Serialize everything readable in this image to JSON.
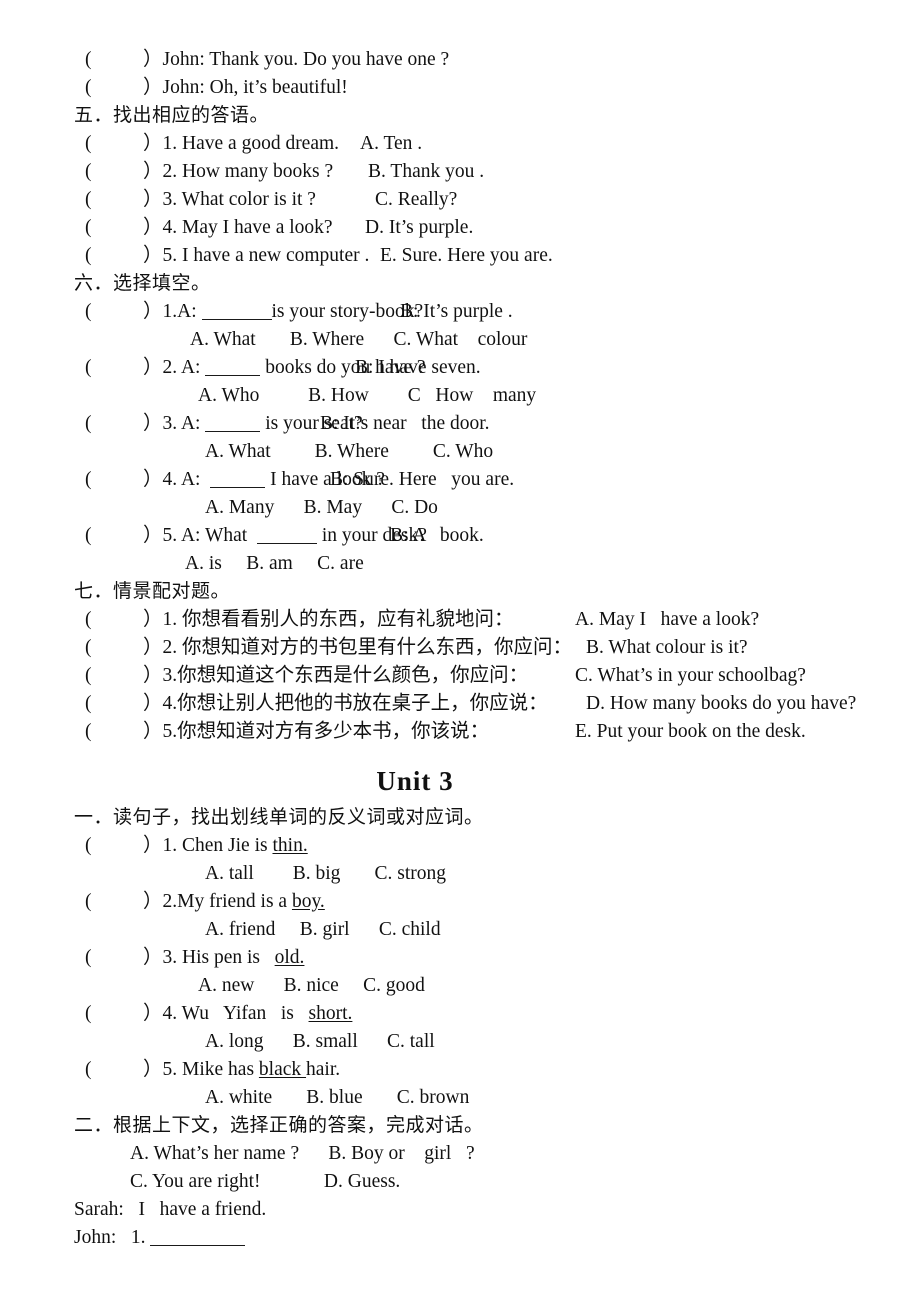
{
  "page": {
    "carryover_lines": [
      "John: Thank you. Do you have one ?",
      "John: Oh, it’s beautiful!"
    ],
    "sections": [
      {
        "id": "five",
        "heading": "五．找出相应的答语。",
        "items": [
          {
            "left": "1. Have a good dream.",
            "right": "A. Ten ."
          },
          {
            "left": "2. How many books ?",
            "right": "B. Thank you ."
          },
          {
            "left": "3. What color is it ?",
            "right": "C. Really?"
          },
          {
            "left": "4. May I have a look?",
            "right": "D. It’s purple."
          },
          {
            "left": "5. I have a new computer .",
            "right": "E. Sure. Here you are."
          }
        ]
      },
      {
        "id": "six",
        "heading": "六．选择填空。",
        "items": [
          {
            "num": "1.A:",
            "pre": "",
            "post": "is your story-book?",
            "answer": "B: It’s purple .",
            "options": "A. What       B. Where      C. What    colour"
          },
          {
            "num": "2. A:",
            "pre": "",
            "post": " books do you have ?",
            "answer": "B: I have seven.",
            "options": "A. Who          B. How        C   How    many"
          },
          {
            "num": "3. A:",
            "pre": "",
            "post": " is your seat?",
            "answer": "B: It’s near   the door.",
            "options": "A. What         B. Where         C. Who"
          },
          {
            "num": "4. A:",
            "pre": "",
            "post": " I have a look ?",
            "answer": "B: Sure. Here   you are.",
            "options": "A. Many      B. May      C. Do"
          },
          {
            "num": "5. A: What",
            "pre": "",
            "post": " in your desk?",
            "answer": "B: A   book.",
            "options": "A. is     B. am     C. are"
          }
        ]
      },
      {
        "id": "seven",
        "heading": "七．情景配对题。",
        "items": [
          {
            "left": "1. 你想看看别人的东西，应有礼貌地问：",
            "right": "A. May I   have a look?"
          },
          {
            "left": "2. 你想知道对方的书包里有什么东西，你应问：",
            "right": "B. What colour is it?"
          },
          {
            "left": "3.你想知道这个东西是什么颜色，你应问：",
            "right": "C. What’s in your schoolbag?"
          },
          {
            "left": "4.你想让别人把他的书放在桌子上，你应说：",
            "right": "D. How many books do you have?"
          },
          {
            "left": "5.你想知道对方有多少本书，你该说：",
            "right": "E. Put your book on the desk."
          }
        ]
      }
    ],
    "unit_title": "Unit    3",
    "unit_sections": [
      {
        "id": "one",
        "heading": "一．读句子，找出划线单词的反义词或对应词。",
        "items": [
          {
            "num": "1. Chen Jie is ",
            "underlined": "thin.",
            "tail": "",
            "options": "A. tall        B. big       C. strong"
          },
          {
            "num": "2.My friend is a ",
            "underlined": "boy.",
            "tail": "",
            "options": "A. friend     B. girl      C. child"
          },
          {
            "num": "3. His pen is   ",
            "underlined": "old.",
            "tail": "",
            "options": "A. new      B. nice     C. good"
          },
          {
            "num": "4. Wu   Yifan   is   ",
            "underlined": "short.",
            "tail": "",
            "options": "A. long      B. small      C. tall"
          },
          {
            "num": "5. Mike has ",
            "underlined": "black ",
            "tail": "hair.",
            "options": "A. white       B. blue       C. brown"
          }
        ]
      },
      {
        "id": "two",
        "heading": "二．根据上下文，选择正确的答案，完成对话。",
        "choices_row1": "A. What’s her name ?      B. Boy or    girl   ?",
        "choices_row2": "C. You are right!             D. Guess.",
        "dialog": [
          {
            "speaker": "Sarah:",
            "text": "I   have a friend."
          },
          {
            "speaker": "John:",
            "text": "1. ",
            "has_blank": true
          }
        ]
      }
    ]
  }
}
